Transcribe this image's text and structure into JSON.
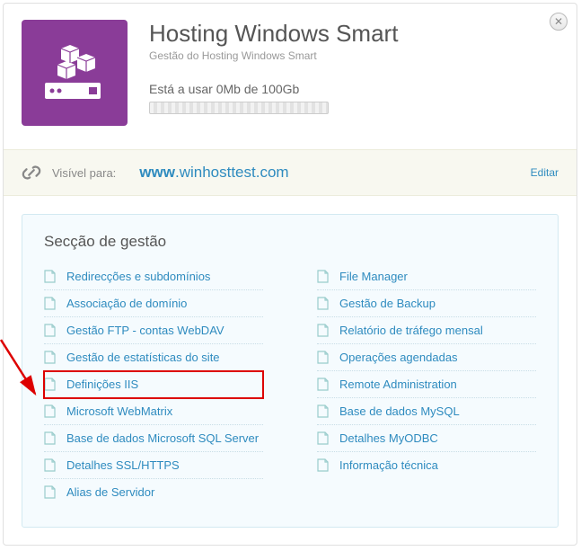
{
  "header": {
    "title": "Hosting Windows Smart",
    "subtitle": "Gestão do Hosting Windows Smart",
    "usage": "Está a usar 0Mb de 100Gb"
  },
  "visibility": {
    "label": "Visível para:",
    "www": "www",
    "domain": ".winhosttest.com",
    "edit": "Editar"
  },
  "mgmt": {
    "title": "Secção de gestão",
    "left": [
      "Redirecções e subdomínios",
      "Associação de domínio",
      "Gestão FTP - contas WebDAV",
      "Gestão de estatísticas do site",
      "Definições IIS",
      "Microsoft WebMatrix",
      "Base de dados Microsoft SQL Server",
      "Detalhes SSL/HTTPS",
      "Alias de Servidor"
    ],
    "right": [
      "File Manager",
      "Gestão de Backup",
      "Relatório de tráfego mensal",
      "Operações agendadas",
      "Remote Administration",
      "Base de dados MySQL",
      "Detalhes MyODBC",
      "Informação técnica"
    ]
  }
}
